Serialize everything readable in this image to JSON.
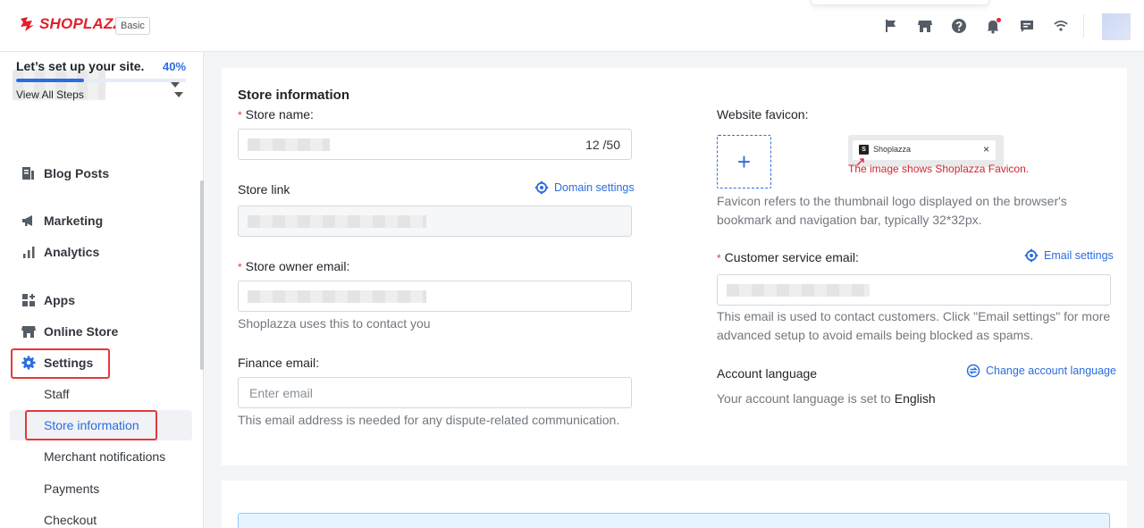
{
  "header": {
    "brand": "SHOPLAZZA",
    "plan_badge": "Basic",
    "icons": [
      "flag-icon",
      "store-icon",
      "help-icon",
      "bell-icon",
      "chat-icon",
      "wifi-icon"
    ]
  },
  "sidebar": {
    "setup": {
      "title": "Let’s set up your site.",
      "progress_text": "40%",
      "progress_fraction": 0.4,
      "view_steps": "View All Steps"
    },
    "items": [
      {
        "label": "Blog Posts",
        "icon": "blog-icon"
      },
      {
        "label": "Marketing",
        "icon": "megaphone-icon"
      },
      {
        "label": "Analytics",
        "icon": "bar-chart-icon"
      },
      {
        "label": "Apps",
        "icon": "apps-icon"
      },
      {
        "label": "Online Store",
        "icon": "store-icon"
      },
      {
        "label": "Settings",
        "icon": "gear-icon"
      }
    ],
    "sub_items": [
      "Staff",
      "Store information",
      "Merchant notifications",
      "Payments",
      "Checkout"
    ],
    "active_sub_item": "Store information"
  },
  "main": {
    "section_title": "Store information",
    "store_name": {
      "label": "Store name",
      "colon": ":",
      "counter": "12 /50"
    },
    "store_link": {
      "label": "Store link",
      "link": "Domain settings"
    },
    "owner_email": {
      "label": "Store owner email",
      "colon": ":",
      "help": "Shoplazza uses this to contact you"
    },
    "finance_email": {
      "label": "Finance email",
      "colon": ":",
      "placeholder": "Enter email",
      "help": "This email address is needed for any dispute-related communication."
    },
    "favicon": {
      "label": "Website favicon",
      "colon": ":",
      "upload_symbol": "+",
      "preview_tab_title": "Shoplazza",
      "preview_close": "×",
      "caption": "The image shows Shoplazza Favicon.",
      "help": "Favicon refers to the thumbnail logo displayed on the browser's bookmark and navigation bar, typically 32*32px."
    },
    "customer_email": {
      "label": "Customer service email",
      "colon": ":",
      "link": "Email settings",
      "help": "This email is used to contact customers. Click \"Email settings\" for more advanced setup to avoid emails being blocked as spams."
    },
    "account_language": {
      "label": "Account language",
      "link": "Change account language",
      "help_prefix": "Your account language is set to",
      "language": "English"
    }
  },
  "colors": {
    "accent": "#2b6de1",
    "brand_red": "#e0202b",
    "highlight_red": "#e5393b"
  }
}
